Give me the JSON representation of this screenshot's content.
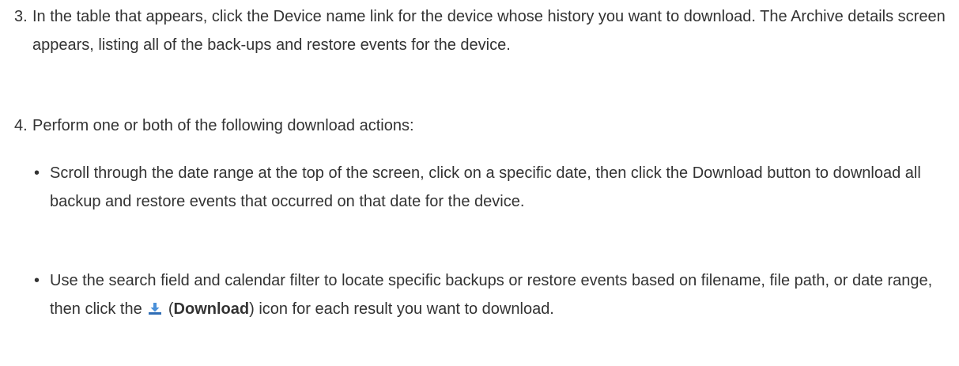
{
  "steps": [
    {
      "number": "3.",
      "text": "In the table that appears, click the Device name link for the device whose history you want to download. The Archive details screen appears, listing all of the back-ups and restore events for the device."
    },
    {
      "number": "4.",
      "text": "Perform one or both of the following download actions:"
    }
  ],
  "bullets": [
    {
      "symbol": "•",
      "text": "Scroll through the date range at the top of the screen, click on a specific date, then click the Download button to download all backup and restore events that occurred on that date for the device."
    },
    {
      "symbol": "•",
      "text_before": "Use the search field and calendar filter to locate specific backups or restore events based on filename, file path, or date range, then click the",
      "open_paren": "(",
      "bold_label": "Download",
      "close_paren": ")",
      "text_after": "icon for each result you want to download.",
      "icon": "download-icon"
    }
  ],
  "colors": {
    "text": "#333333",
    "icon_blue": "#4a90d9",
    "icon_base": "#2f6db5"
  }
}
